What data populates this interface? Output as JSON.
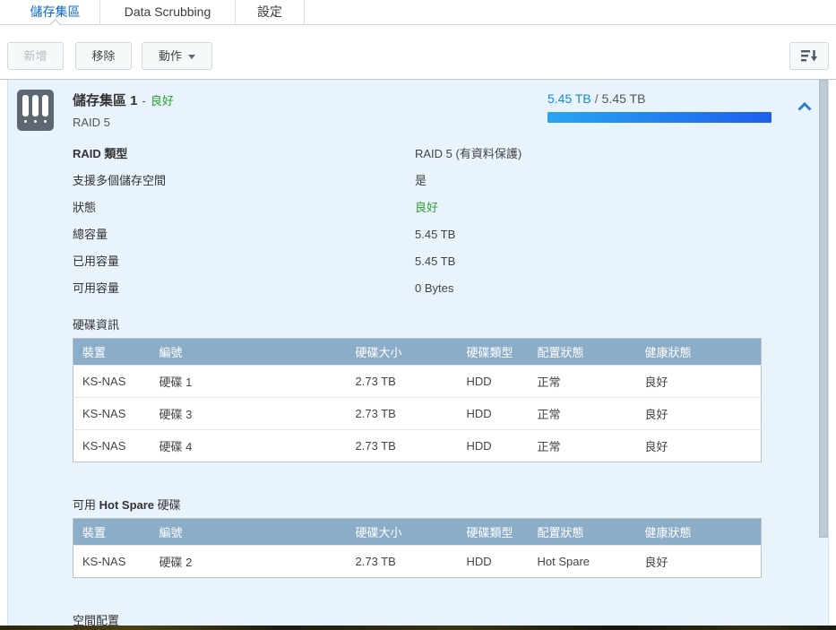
{
  "tabs": [
    {
      "label": "儲存集區",
      "active": true
    },
    {
      "label": "Data Scrubbing",
      "active": false
    },
    {
      "label": "設定",
      "active": false
    }
  ],
  "toolbar": {
    "add_label": "新增",
    "remove_label": "移除",
    "action_label": "動作"
  },
  "icons": {
    "sort": "sort-descending-icon",
    "action_caret": "caret-down-icon",
    "collapse": "chevron-up-icon",
    "pool": "drive-bays-icon"
  },
  "pool": {
    "title": "儲存集區 1",
    "title_separator": "-",
    "status": "良好",
    "raid_type_short": "RAID 5",
    "capacity_used": "5.45 TB",
    "capacity_divider": "/",
    "capacity_total": "5.45 TB",
    "details": [
      {
        "label": "RAID 類型",
        "value": "RAID 5 (有資料保護)"
      },
      {
        "label": "支援多個儲存空間",
        "value": "是"
      },
      {
        "label": "狀態",
        "value": "良好"
      },
      {
        "label": "總容量",
        "value": "5.45 TB"
      },
      {
        "label": "已用容量",
        "value": "5.45 TB"
      },
      {
        "label": "可用容量",
        "value": "0 Bytes"
      }
    ],
    "disk_info": {
      "title": "硬碟資訊",
      "columns": [
        "裝置",
        "編號",
        "硬碟大小",
        "硬碟類型",
        "配置狀態",
        "健康狀態"
      ],
      "rows": [
        {
          "device": "KS-NAS",
          "number": "硬碟 1",
          "size": "2.73 TB",
          "type": "HDD",
          "allocation": "正常",
          "health": "良好"
        },
        {
          "device": "KS-NAS",
          "number": "硬碟 3",
          "size": "2.73 TB",
          "type": "HDD",
          "allocation": "正常",
          "health": "良好"
        },
        {
          "device": "KS-NAS",
          "number": "硬碟 4",
          "size": "2.73 TB",
          "type": "HDD",
          "allocation": "正常",
          "health": "良好"
        }
      ]
    },
    "hot_spare": {
      "title_prefix": "可用 ",
      "title_emphasis": "Hot Spare",
      "title_suffix": " 硬碟",
      "columns": [
        "裝置",
        "編號",
        "硬碟大小",
        "硬碟類型",
        "配置狀態",
        "健康狀態"
      ],
      "rows": [
        {
          "device": "KS-NAS",
          "number": "硬碟 2",
          "size": "2.73 TB",
          "type": "HDD",
          "allocation": "Hot Spare",
          "health": "良好"
        }
      ]
    },
    "next_section_title": "空間配置"
  },
  "colors": {
    "active_tab_blue": "#0c6cc4",
    "capacity_text_blue": "#1588d1",
    "status_green": "#2f9e31",
    "table_header_bg": "#8cadc8",
    "panel_bg": "#e8f3fc",
    "bar_gradient_start": "#27a5f2",
    "bar_gradient_end": "#1d5ff0"
  }
}
